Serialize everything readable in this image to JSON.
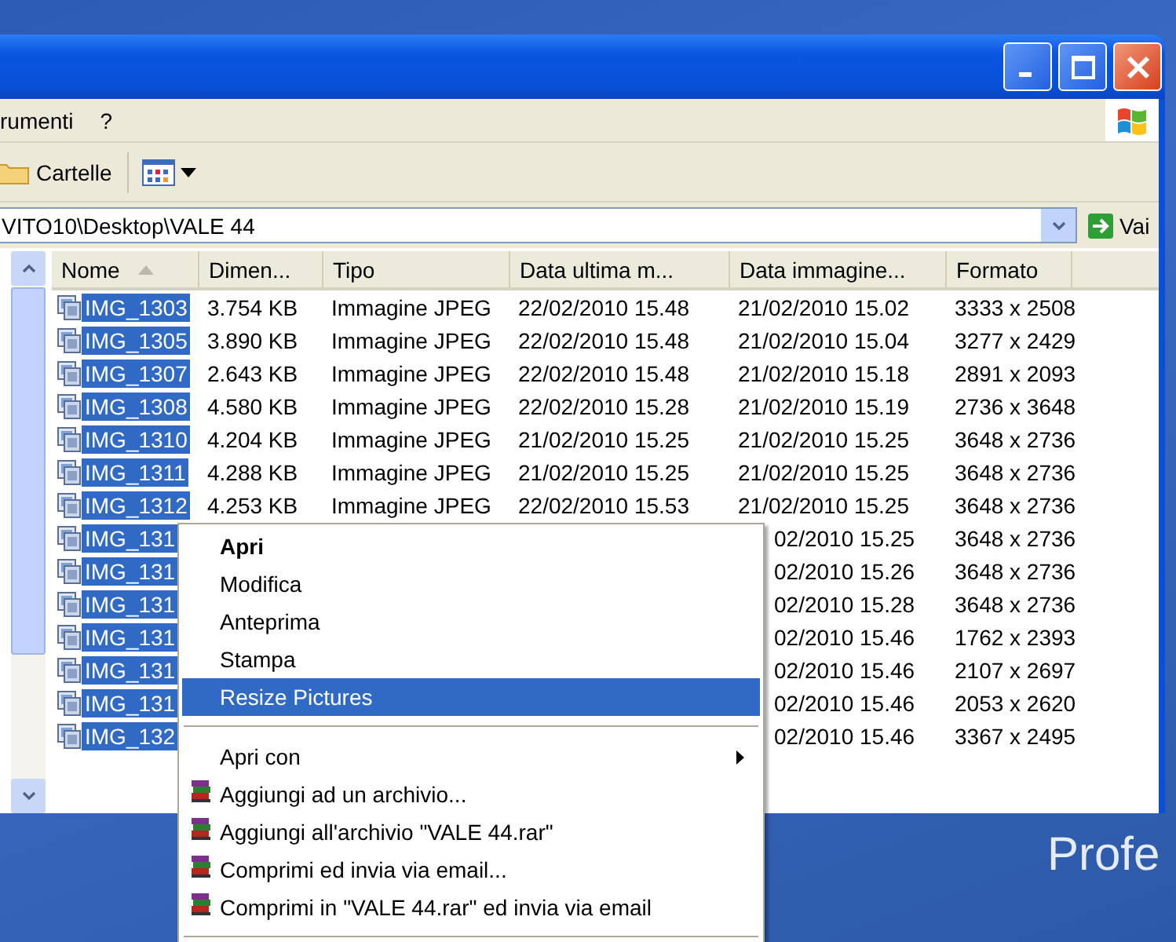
{
  "window": {
    "menu_bar": [
      "rumenti",
      "?"
    ],
    "toolbar": {
      "folders_button": "Cartelle"
    },
    "address": {
      "value": "VITO10\\Desktop\\VALE 44",
      "go_button": "Vai"
    }
  },
  "file_list": {
    "columns": [
      {
        "label": "Nome",
        "sorted": true
      },
      {
        "label": "Dimen...",
        "sorted": false
      },
      {
        "label": "Tipo",
        "sorted": false
      },
      {
        "label": "Data ultima m...",
        "sorted": false
      },
      {
        "label": "Data immagine...",
        "sorted": false
      },
      {
        "label": "Formato",
        "sorted": false
      }
    ],
    "rows": [
      {
        "selected": true,
        "cells": [
          "IMG_1303",
          "3.754 KB",
          "Immagine JPEG",
          "22/02/2010 15.48",
          "21/02/2010 15.02",
          "3333 x 2508"
        ]
      },
      {
        "selected": true,
        "cells": [
          "IMG_1305",
          "3.890 KB",
          "Immagine JPEG",
          "22/02/2010 15.48",
          "21/02/2010 15.04",
          "3277 x 2429"
        ]
      },
      {
        "selected": true,
        "cells": [
          "IMG_1307",
          "2.643 KB",
          "Immagine JPEG",
          "22/02/2010 15.48",
          "21/02/2010 15.18",
          "2891 x 2093"
        ]
      },
      {
        "selected": true,
        "cells": [
          "IMG_1308",
          "4.580 KB",
          "Immagine JPEG",
          "22/02/2010 15.28",
          "21/02/2010 15.19",
          "2736 x 3648"
        ]
      },
      {
        "selected": true,
        "cells": [
          "IMG_1310",
          "4.204 KB",
          "Immagine JPEG",
          "21/02/2010 15.25",
          "21/02/2010 15.25",
          "3648 x 2736"
        ]
      },
      {
        "selected": true,
        "cells": [
          "IMG_1311",
          "4.288 KB",
          "Immagine JPEG",
          "21/02/2010 15.25",
          "21/02/2010 15.25",
          "3648 x 2736"
        ]
      },
      {
        "selected": true,
        "cells": [
          "IMG_1312",
          "4.253 KB",
          "Immagine JPEG",
          "22/02/2010 15.53",
          "21/02/2010 15.25",
          "3648 x 2736"
        ]
      },
      {
        "selected": true,
        "cells": [
          "IMG_131",
          null,
          null,
          null,
          "02/2010 15.25",
          "3648 x 2736"
        ]
      },
      {
        "selected": true,
        "cells": [
          "IMG_131",
          null,
          null,
          null,
          "02/2010 15.26",
          "3648 x 2736"
        ]
      },
      {
        "selected": true,
        "cells": [
          "IMG_131",
          null,
          null,
          null,
          "02/2010 15.28",
          "3648 x 2736"
        ]
      },
      {
        "selected": true,
        "cells": [
          "IMG_131",
          null,
          null,
          null,
          "02/2010 15.46",
          "1762 x 2393"
        ]
      },
      {
        "selected": true,
        "cells": [
          "IMG_131",
          null,
          null,
          null,
          "02/2010 15.46",
          "2107 x 2697"
        ]
      },
      {
        "selected": true,
        "cells": [
          "IMG_131",
          null,
          null,
          null,
          "02/2010 15.46",
          "2053 x 2620"
        ]
      },
      {
        "selected": true,
        "cells": [
          "IMG_132",
          null,
          null,
          null,
          "02/2010 15.46",
          "3367 x 2495"
        ]
      }
    ]
  },
  "context_menu": {
    "items": [
      {
        "kind": "item",
        "label": "Apri",
        "bold": true,
        "selected": false
      },
      {
        "kind": "item",
        "label": "Modifica",
        "bold": false,
        "selected": false
      },
      {
        "kind": "item",
        "label": "Anteprima",
        "bold": false,
        "selected": false
      },
      {
        "kind": "item",
        "label": "Stampa",
        "bold": false,
        "selected": false
      },
      {
        "kind": "item",
        "label": "Resize Pictures",
        "bold": false,
        "selected": true
      },
      {
        "kind": "separator"
      },
      {
        "kind": "submenu",
        "label": "Apri con",
        "bold": false,
        "selected": false
      },
      {
        "kind": "archive",
        "label": "Aggiungi ad un archivio...",
        "bold": false,
        "selected": false
      },
      {
        "kind": "archive",
        "label": "Aggiungi all'archivio \"VALE 44.rar\"",
        "bold": false,
        "selected": false
      },
      {
        "kind": "archive",
        "label": "Comprimi ed invia via email...",
        "bold": false,
        "selected": false
      },
      {
        "kind": "archive",
        "label": "Comprimi in \"VALE 44.rar\" ed invia via email",
        "bold": false,
        "selected": false
      },
      {
        "kind": "separator"
      }
    ]
  },
  "desktop": {
    "wallpaper_text": "Profe"
  }
}
